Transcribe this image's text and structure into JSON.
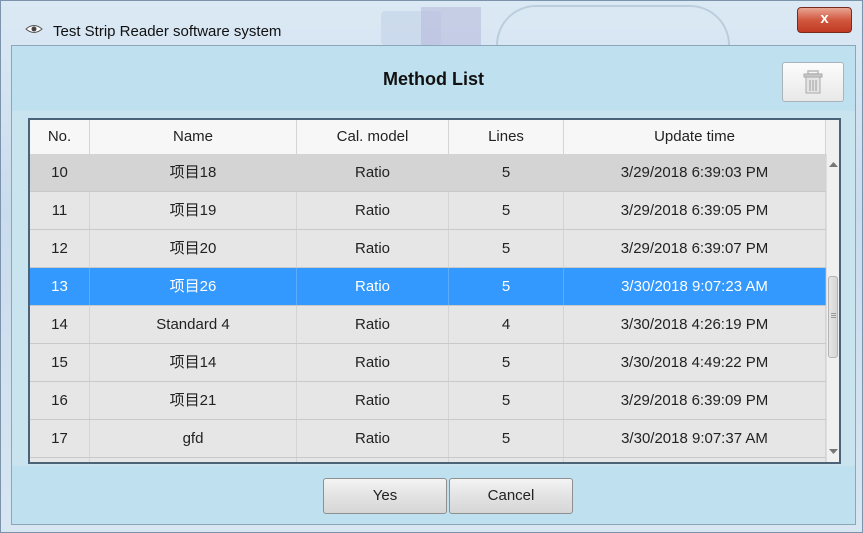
{
  "window": {
    "title": "Test Strip Reader software system",
    "close_label": "x",
    "app_icon": "eye-app-icon"
  },
  "dialog": {
    "title": "Method List",
    "delete_icon": "trash-icon"
  },
  "table": {
    "columns": [
      "No.",
      "Name",
      "Cal. model",
      "Lines",
      "Update time"
    ],
    "rows": [
      {
        "no": "10",
        "name": "项目18",
        "cal": "Ratio",
        "lines": "5",
        "updated": "3/29/2018 6:39:03 PM"
      },
      {
        "no": "11",
        "name": "项目19",
        "cal": "Ratio",
        "lines": "5",
        "updated": "3/29/2018 6:39:05 PM"
      },
      {
        "no": "12",
        "name": "项目20",
        "cal": "Ratio",
        "lines": "5",
        "updated": "3/29/2018 6:39:07 PM"
      },
      {
        "no": "13",
        "name": "项目26",
        "cal": "Ratio",
        "lines": "5",
        "updated": "3/30/2018 9:07:23 AM"
      },
      {
        "no": "14",
        "name": "Standard 4",
        "cal": "Ratio",
        "lines": "4",
        "updated": "3/30/2018 4:26:19 PM"
      },
      {
        "no": "15",
        "name": "项目14",
        "cal": "Ratio",
        "lines": "5",
        "updated": "3/30/2018 4:49:22 PM"
      },
      {
        "no": "16",
        "name": "项目21",
        "cal": "Ratio",
        "lines": "5",
        "updated": "3/29/2018 6:39:09 PM"
      },
      {
        "no": "17",
        "name": "gfd",
        "cal": "Ratio",
        "lines": "5",
        "updated": "3/30/2018 9:07:37 AM"
      }
    ],
    "selected_no": "13"
  },
  "buttons": {
    "yes": "Yes",
    "cancel": "Cancel"
  },
  "colors": {
    "selection": "#3399ff",
    "dialog_bg": "#c9e3ef"
  }
}
